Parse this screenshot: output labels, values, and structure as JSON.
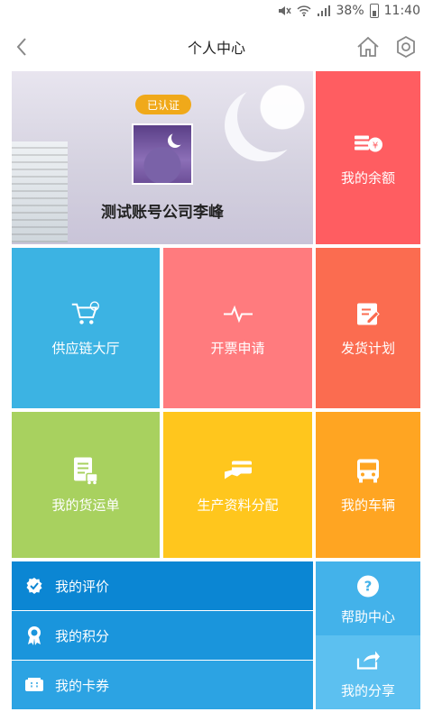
{
  "status_bar": {
    "battery": "38%",
    "time": "11:40"
  },
  "header": {
    "title": "个人中心"
  },
  "profile": {
    "verified_label": "已认证",
    "company_name": "测试账号公司李峰"
  },
  "tiles": {
    "balance": "我的余额",
    "supply_chain": "供应链大厅",
    "invoice_request": "开票申请",
    "shipping_plan": "发货计划",
    "waybill": "我的货运单",
    "production_allocation": "生产资料分配",
    "vehicles": "我的车辆",
    "help_center": "帮助中心",
    "share": "我的分享"
  },
  "list": [
    {
      "label": "我的评价",
      "icon": "check-badge-icon"
    },
    {
      "label": "我的积分",
      "icon": "award-icon"
    },
    {
      "label": "我的卡券",
      "icon": "coupon-icon"
    }
  ],
  "colors": {
    "balance": "#ff5d61",
    "supply": "#3cb3e3",
    "invoice": "#ff7b7e",
    "plan": "#fb6c50",
    "waybill": "#a8d15f",
    "allocation": "#ffc61d",
    "vehicles": "#ffa522",
    "list_dark": "#0b86d3",
    "help": "#43b2ea",
    "share": "#5cc0f0",
    "badge": "#f0a91a"
  }
}
